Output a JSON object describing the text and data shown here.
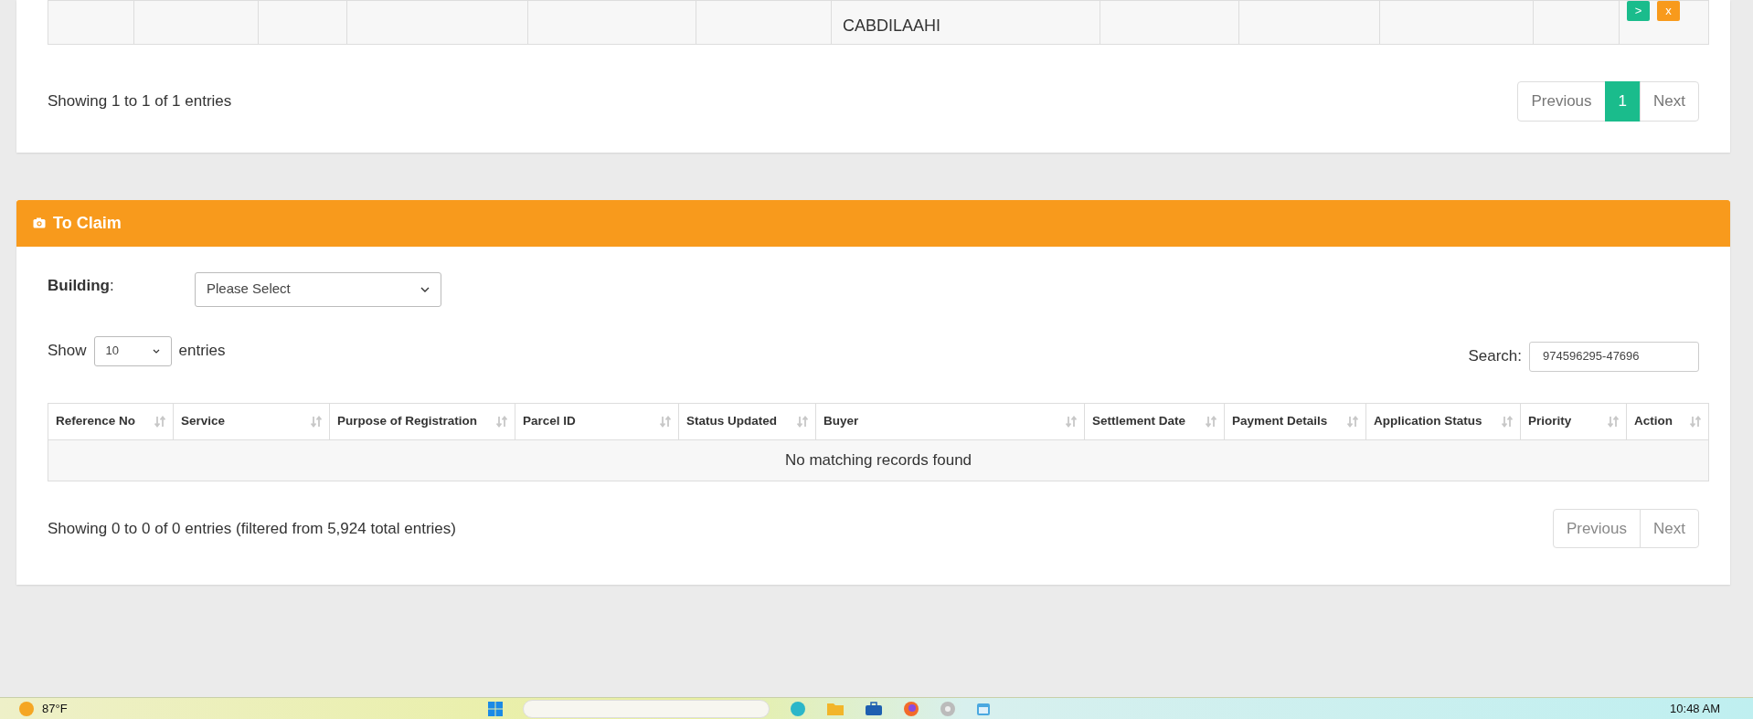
{
  "top_table": {
    "buyer_line": "CABDILAAHI",
    "actions": [
      {
        "label": ">",
        "kind": "go"
      },
      {
        "label": "x",
        "kind": "cancel"
      }
    ]
  },
  "top_footer": {
    "info": "Showing 1 to 1 of 1 entries",
    "pagination": [
      {
        "label": "Previous",
        "selected": false
      },
      {
        "label": "1",
        "selected": true
      },
      {
        "label": "Next",
        "selected": false
      }
    ]
  },
  "claim_panel": {
    "title": "To Claim",
    "building": {
      "label": "**Building**:",
      "value": "Please Select"
    },
    "length": {
      "prefix": "Show",
      "value": "10",
      "suffix": "entries"
    },
    "search": {
      "label": "Search:",
      "value": "974596295-47696"
    },
    "columns": [
      "Reference No",
      "Service",
      "Purpose of Registration",
      "Parcel ID",
      "Status Updated",
      "Buyer",
      "Settlement Date",
      "Payment Details",
      "Application Status",
      "Priority",
      "Action"
    ],
    "empty_message": "No matching records found",
    "info": "Showing 0 to 0 of 0 entries (filtered from 5,924 total entries)",
    "pagination": [
      {
        "label": "Previous",
        "disabled": true
      },
      {
        "label": "Next",
        "disabled": true
      }
    ]
  },
  "taskbar": {
    "weather": "87°F",
    "clock": "10:48 AM"
  }
}
